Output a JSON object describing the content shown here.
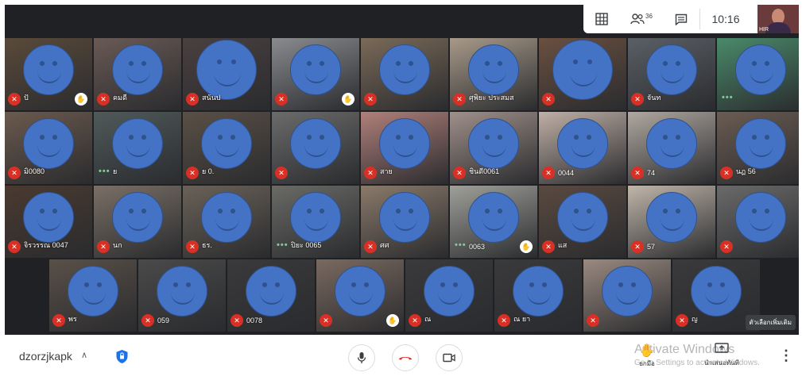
{
  "topbar": {
    "participants_count": "36",
    "time": "10:16",
    "self_tag": "HIR"
  },
  "tiles": {
    "row1": [
      {
        "name": "ปั",
        "muted": true,
        "hand": true,
        "big": false,
        "bg": "#5a4a3a"
      },
      {
        "name": "คมดี",
        "muted": true,
        "big": false,
        "bg": "#6a5a55"
      },
      {
        "name": "สนันป",
        "muted": true,
        "big": true,
        "bg": "#4a4040"
      },
      {
        "name": "",
        "muted": true,
        "hand": true,
        "big": false,
        "bg": "#8a8b8e"
      },
      {
        "name": "",
        "muted": true,
        "big": false,
        "bg": "#7a6a58"
      },
      {
        "name": "ศุพิยะ ประสมส",
        "muted": true,
        "big": false,
        "bg": "#a89a8a"
      },
      {
        "name": "",
        "muted": true,
        "big": true,
        "bg": "#6a5040"
      },
      {
        "name": "จันท",
        "muted": true,
        "big": false,
        "bg": "#5b6066"
      },
      {
        "name": "",
        "dots": true,
        "big": false,
        "bg": "#4a8a6a"
      }
    ],
    "row2": [
      {
        "name": "มิ0080",
        "muted": true,
        "big": false,
        "bg": "#6b5a4e"
      },
      {
        "name": "ย",
        "dots": true,
        "big": false,
        "bg": "#505a5a"
      },
      {
        "name": "ย 0.",
        "muted": true,
        "big": false,
        "bg": "#5a5046"
      },
      {
        "name": "",
        "muted": true,
        "big": false,
        "bg": "#6b6b6b"
      },
      {
        "name": "สาย",
        "muted": true,
        "big": false,
        "bg": "#b0807a"
      },
      {
        "name": "ชินดี0061",
        "muted": true,
        "big": false,
        "bg": "#a0908a"
      },
      {
        "name": "0044",
        "muted": true,
        "big": false,
        "bg": "#c0b0a6"
      },
      {
        "name": "74",
        "muted": true,
        "big": false,
        "bg": "#b0a8a0"
      },
      {
        "name": "นฏ 56",
        "muted": true,
        "big": false,
        "bg": "#6a5c52"
      }
    ],
    "row3": [
      {
        "name": "จิรวรรณ 0047",
        "muted": true,
        "big": false,
        "bg": "#4a3a30"
      },
      {
        "name": "นก",
        "muted": true,
        "big": false,
        "bg": "#7a7066"
      },
      {
        "name": "ธร.",
        "muted": true,
        "big": false,
        "bg": "#6a6258"
      },
      {
        "name": "ปิยะ 0065",
        "dots": true,
        "big": false,
        "bg": "#6a6a66"
      },
      {
        "name": "ศศ",
        "muted": true,
        "big": false,
        "bg": "#8a7a6a"
      },
      {
        "name": "0063",
        "dots": true,
        "hand": true,
        "big": false,
        "bg": "#a0a09a"
      },
      {
        "name": "แส",
        "muted": true,
        "big": false,
        "bg": "#5a4a40"
      },
      {
        "name": "57",
        "muted": true,
        "big": false,
        "bg": "#c0b6aa"
      },
      {
        "name": "",
        "muted": true,
        "big": false,
        "bg": "#6a6a6a"
      }
    ],
    "row4": [
      {
        "name": "พร",
        "muted": true,
        "big": false,
        "bg": "#5a5048"
      },
      {
        "name": "059",
        "muted": true,
        "big": false,
        "bg": "#4a4a4a"
      },
      {
        "name": "0078",
        "muted": true,
        "big": false,
        "bg": "#3a3a3c"
      },
      {
        "name": "",
        "muted": true,
        "hand": true,
        "big": false,
        "bg": "#7a6a60"
      },
      {
        "name": "ณ",
        "muted": true,
        "big": false,
        "bg": "#3a3a3c"
      },
      {
        "name": "ณ ยา",
        "muted": true,
        "big": false,
        "bg": "#3a3a3c"
      },
      {
        "name": "",
        "muted": true,
        "big": false,
        "bg": "#9a8a80"
      },
      {
        "name": "ญ",
        "muted": true,
        "big": false,
        "bg": "#3a3a3c"
      }
    ]
  },
  "pin_label": "ตัวเลือกเพิ่มเติม",
  "controls": {
    "meeting_code": "dzorzjkapk",
    "raise_hand_label": "ยกมือ",
    "present_label": "นำเสนอทันที"
  },
  "watermark": {
    "line1": "Activate Windows",
    "line2": "Go to Settings to activate Windows."
  },
  "colors": {
    "meet_bg": "#202124",
    "avatar": "#4472c4",
    "muted": "#d93025",
    "end_call": "#d93025"
  }
}
